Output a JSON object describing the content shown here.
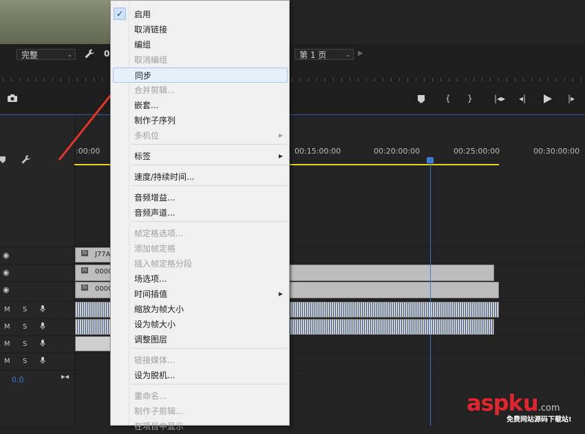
{
  "monitor": {
    "quality": "完整",
    "zoom_partial": "0",
    "page": "第 1 页"
  },
  "timeline": {
    "timecodes": [
      ":00:00",
      "00:15:00:00",
      "00:20:00:00",
      "00:25:00:00",
      "00:30:00:00"
    ],
    "clips": {
      "v3": "J77A",
      "v2": "0000",
      "v1": "0000"
    },
    "audio_labels": {
      "m": "M",
      "s": "S"
    },
    "volume": "0.0"
  },
  "menu": {
    "items": [
      {
        "label": "启用",
        "checked": true
      },
      {
        "label": "取消链接"
      },
      {
        "label": "编组"
      },
      {
        "label": "取消编组",
        "disabled": true
      },
      {
        "label": "同步",
        "highlighted": true
      },
      {
        "label": "合并剪辑...",
        "disabled": true
      },
      {
        "label": "嵌套..."
      },
      {
        "label": "制作子序列"
      },
      {
        "label": "多机位",
        "disabled": true,
        "submenu": true
      },
      {
        "label": "标签",
        "submenu": true
      },
      {
        "label": "速度/持续时间..."
      },
      {
        "label": "音频增益..."
      },
      {
        "label": "音频声道..."
      },
      {
        "label": "帧定格选项...",
        "disabled": true
      },
      {
        "label": "添加帧定格",
        "disabled": true
      },
      {
        "label": "插入帧定格分段",
        "disabled": true
      },
      {
        "label": "场选项..."
      },
      {
        "label": "时间插值",
        "submenu": true
      },
      {
        "label": "缩放为帧大小"
      },
      {
        "label": "设为帧大小"
      },
      {
        "label": "调整图层"
      },
      {
        "label": "链接媒体...",
        "disabled": true
      },
      {
        "label": "设为脱机..."
      },
      {
        "label": "重命名...",
        "disabled": true
      },
      {
        "label": "制作子剪辑...",
        "disabled": true
      },
      {
        "label": "在项目中显示",
        "disabled": true
      }
    ]
  },
  "watermark": {
    "brand_a": "asp",
    "brand_k": "k",
    "brand_u": "u",
    "domain": ".com",
    "subtitle": "免费网站源码下载站!"
  },
  "colors": {
    "accent_blue": "#3b7ad6",
    "work_area": "#e8d61f",
    "arrow_red": "#e8352c",
    "menu_highlight": "#e5f0fb"
  }
}
